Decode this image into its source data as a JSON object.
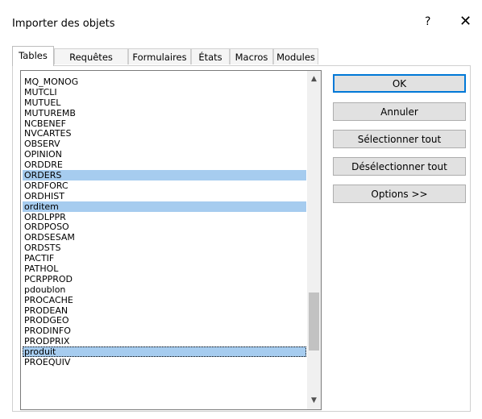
{
  "dialog": {
    "title": "Importer des objets",
    "help": "?",
    "close": "✕"
  },
  "tabs": [
    {
      "label": "Tables",
      "active": true
    },
    {
      "label": "Requêtes",
      "active": false
    },
    {
      "label": "Formulaires",
      "active": false
    },
    {
      "label": "États",
      "active": false
    },
    {
      "label": "Macros",
      "active": false
    },
    {
      "label": "Modules",
      "active": false
    }
  ],
  "list": {
    "items": [
      {
        "label": "MQ_MONOG"
      },
      {
        "label": "MUTCLI"
      },
      {
        "label": "MUTUEL"
      },
      {
        "label": "MUTUREMB"
      },
      {
        "label": "NCBENEF"
      },
      {
        "label": "NVCARTES"
      },
      {
        "label": "OBSERV"
      },
      {
        "label": "OPINION"
      },
      {
        "label": "ORDDRE"
      },
      {
        "label": "ORDERS",
        "selected": true
      },
      {
        "label": "ORDFORC"
      },
      {
        "label": "ORDHIST"
      },
      {
        "label": "orditem",
        "selected": true
      },
      {
        "label": "ORDLPPR"
      },
      {
        "label": "ORDPOSO"
      },
      {
        "label": "ORDSESAM"
      },
      {
        "label": "ORDSTS"
      },
      {
        "label": "PACTIF"
      },
      {
        "label": "PATHOL"
      },
      {
        "label": "PCRPPROD"
      },
      {
        "label": "pdoublon"
      },
      {
        "label": "PROCACHE"
      },
      {
        "label": "PRODEAN"
      },
      {
        "label": "PRODGEO"
      },
      {
        "label": "PRODINFO"
      },
      {
        "label": "PRODPRIX"
      },
      {
        "label": "produit",
        "selected": true,
        "focused": true
      },
      {
        "label": "PROEQUIV"
      }
    ],
    "scroll_up_icon": "▲",
    "scroll_down_icon": "▼"
  },
  "buttons": {
    "ok": "OK",
    "cancel": "Annuler",
    "select_all": "Sélectionner tout",
    "deselect_all": "Désélectionner tout",
    "options": "Options >>"
  }
}
